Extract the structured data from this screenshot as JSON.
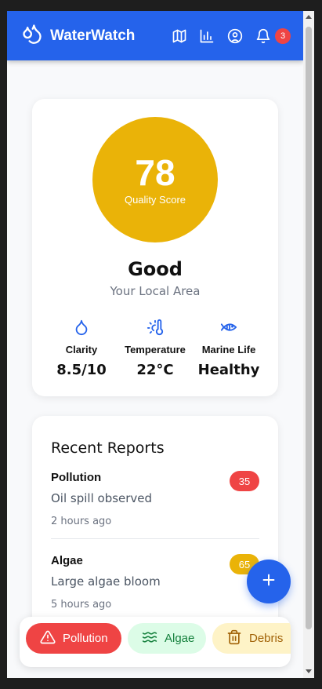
{
  "header": {
    "app_name": "WaterWatch",
    "logo_icon": "water-drops-icon",
    "nav_icons": [
      "map-icon",
      "chart-icon",
      "user-icon",
      "bell-icon"
    ],
    "notification_count": "3",
    "color": "#2563eb"
  },
  "score": {
    "value": "78",
    "label": "Quality Score",
    "status": "Good",
    "location": "Your Local Area",
    "color": "#eab308"
  },
  "metrics": [
    {
      "icon": "droplet-icon",
      "label": "Clarity",
      "value": "8.5/10"
    },
    {
      "icon": "thermometer-icon",
      "label": "Temperature",
      "value": "22°C"
    },
    {
      "icon": "fish-icon",
      "label": "Marine Life",
      "value": "Healthy"
    }
  ],
  "reports": {
    "title": "Recent Reports",
    "items": [
      {
        "type": "Pollution",
        "description": "Oil spill observed",
        "time": "2 hours ago",
        "score": "35",
        "color": "#ef4444"
      },
      {
        "type": "Algae",
        "description": "Large algae bloom",
        "time": "5 hours ago",
        "score": "65",
        "color": "#eab308"
      }
    ]
  },
  "filters": [
    {
      "label": "Pollution",
      "icon": "warning-icon",
      "color": "#ef4444"
    },
    {
      "label": "Algae",
      "icon": "waves-icon",
      "color": "#15803d"
    },
    {
      "label": "Debris",
      "icon": "trash-icon",
      "color": "#a16207"
    }
  ],
  "fab_icon": "plus-icon"
}
